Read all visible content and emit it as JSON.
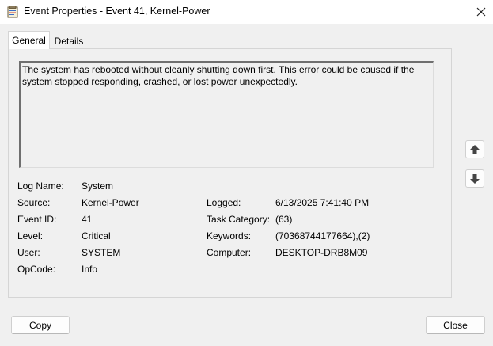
{
  "window": {
    "title": "Event Properties - Event 41, Kernel-Power",
    "icon": "event-viewer-icon"
  },
  "tabs": [
    {
      "label": "General",
      "active": true
    },
    {
      "label": "Details",
      "active": false
    }
  ],
  "description": "The system has rebooted without cleanly shutting down first. This error could be caused if the system stopped responding, crashed, or lost power unexpectedly.",
  "fields": {
    "log_name": {
      "label": "Log Name:",
      "value": "System"
    },
    "source": {
      "label": "Source:",
      "value": "Kernel-Power"
    },
    "event_id": {
      "label": "Event ID:",
      "value": "41"
    },
    "level": {
      "label": "Level:",
      "value": "Critical"
    },
    "user": {
      "label": "User:",
      "value": "SYSTEM"
    },
    "opcode": {
      "label": "OpCode:",
      "value": "Info"
    },
    "logged": {
      "label": "Logged:",
      "value": "6/13/2025 7:41:40 PM"
    },
    "task_category": {
      "label": "Task Category:",
      "value": "(63)"
    },
    "keywords": {
      "label": "Keywords:",
      "value": "(70368744177664),(2)"
    },
    "computer": {
      "label": "Computer:",
      "value": "DESKTOP-DRB8M09"
    }
  },
  "buttons": {
    "copy": "Copy",
    "close": "Close"
  },
  "icons": {
    "up": "arrow-up-icon",
    "down": "arrow-down-icon",
    "close": "close-icon"
  }
}
